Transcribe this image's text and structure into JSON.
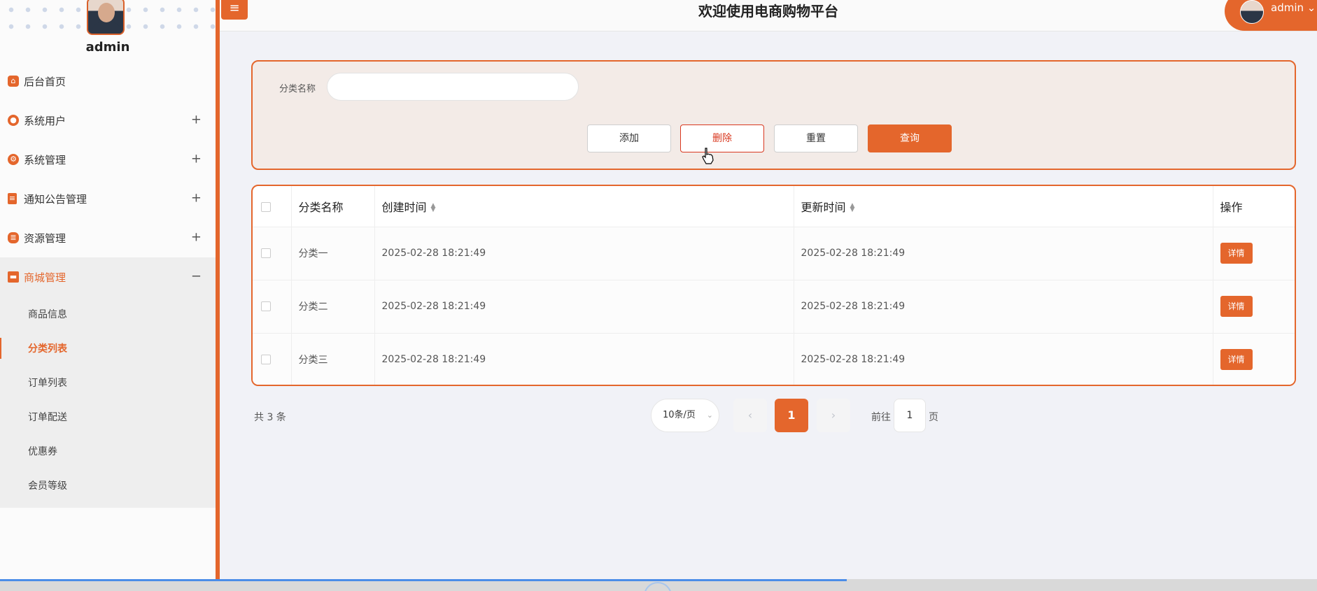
{
  "sidebar": {
    "username": "admin",
    "menu": [
      {
        "label": "后台首页",
        "icon": "home-icon",
        "toggle": ""
      },
      {
        "label": "系统用户",
        "icon": "user-icon",
        "toggle": "+"
      },
      {
        "label": "系统管理",
        "icon": "settings-icon",
        "toggle": "+"
      },
      {
        "label": "通知公告管理",
        "icon": "notice-icon",
        "toggle": "+"
      },
      {
        "label": "资源管理",
        "icon": "database-icon",
        "toggle": "+"
      },
      {
        "label": "商城管理",
        "icon": "shop-icon",
        "toggle": "−"
      }
    ],
    "submenu": [
      {
        "label": "商品信息"
      },
      {
        "label": "分类列表"
      },
      {
        "label": "订单列表"
      },
      {
        "label": "订单配送"
      },
      {
        "label": "优惠券"
      },
      {
        "label": "会员等级"
      }
    ]
  },
  "header": {
    "title": "欢迎使用电商购物平台",
    "user": "admin"
  },
  "search": {
    "label": "分类名称",
    "value": "",
    "placeholder": "",
    "buttons": {
      "add": "添加",
      "delete": "删除",
      "reset": "重置",
      "query": "查询"
    }
  },
  "table": {
    "headers": [
      "分类名称",
      "创建时间",
      "更新时间",
      "操作"
    ],
    "rows": [
      {
        "name": "分类一",
        "created": "2025-02-28 18:21:49",
        "updated": "2025-02-28 18:21:49",
        "action": "详情"
      },
      {
        "name": "分类二",
        "created": "2025-02-28 18:21:49",
        "updated": "2025-02-28 18:21:49",
        "action": "详情"
      },
      {
        "name": "分类三",
        "created": "2025-02-28 18:21:49",
        "updated": "2025-02-28 18:21:49",
        "action": "详情"
      }
    ]
  },
  "pagination": {
    "total": "共 3 条",
    "page_size": "10条/页",
    "current_page": "1",
    "goto_prefix": "前往",
    "goto_value": "1",
    "goto_suffix": "页"
  },
  "colors": {
    "accent": "#e4662c",
    "danger": "#d8381f"
  }
}
